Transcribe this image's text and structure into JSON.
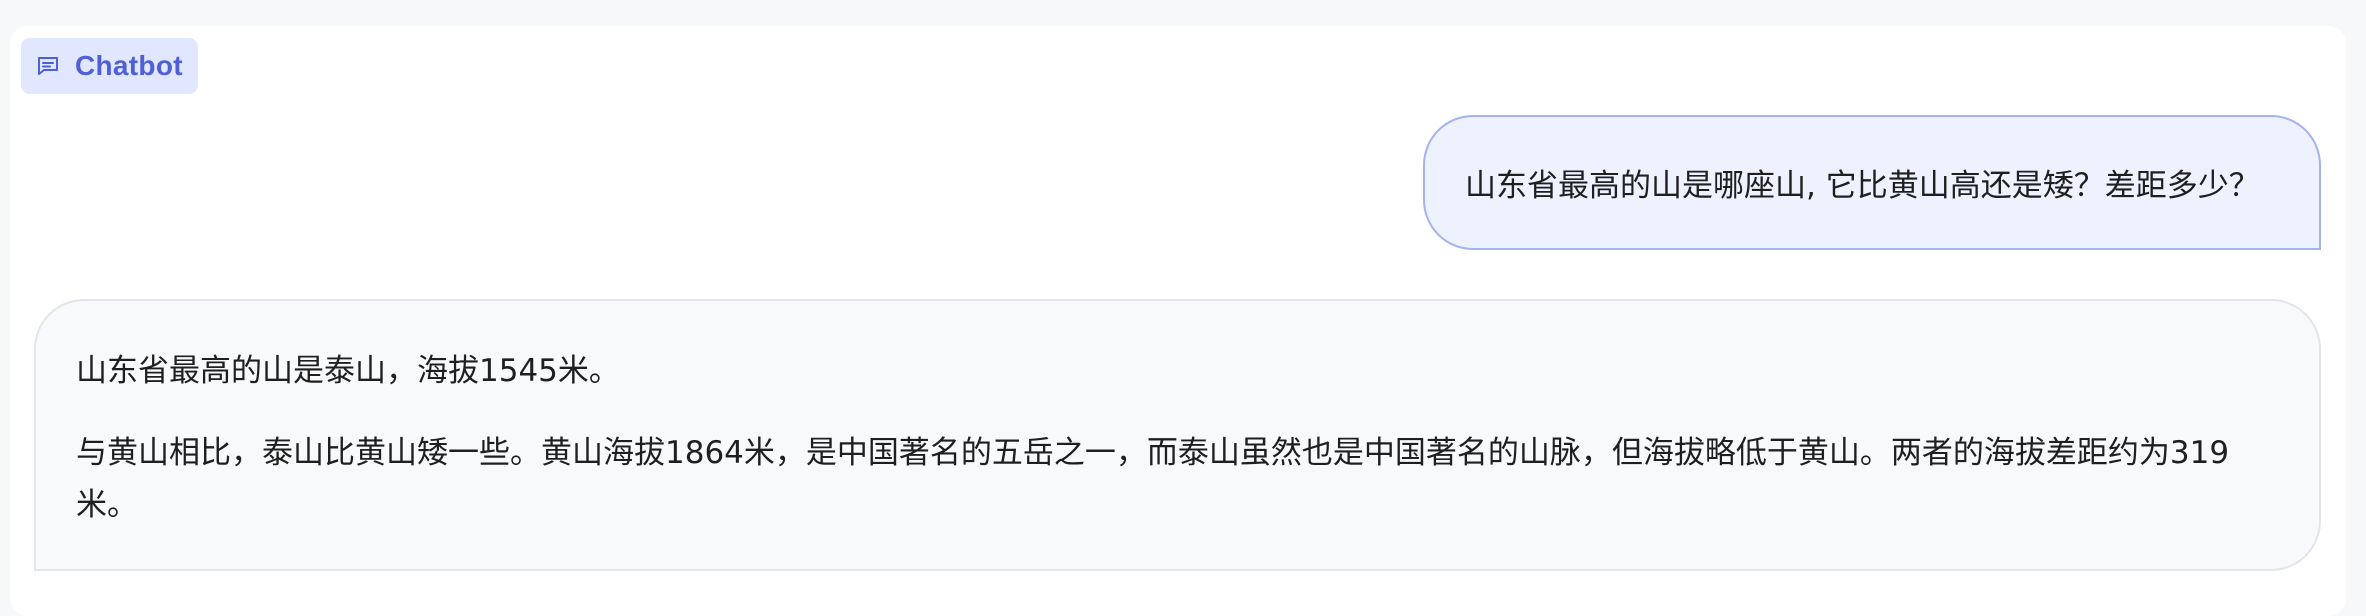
{
  "header": {
    "label": "Chatbot",
    "icon": "chat-bubble-icon",
    "accent_color": "#4f5fd6"
  },
  "messages": [
    {
      "role": "user",
      "text": "山东省最高的山是哪座山, 它比黄山高还是矮？差距多少？"
    },
    {
      "role": "assistant",
      "paragraphs": [
        "山东省最高的山是泰山，海拔1545米。",
        "与黄山相比，泰山比黄山矮一些。黄山海拔1864米，是中国著名的五岳之一，而泰山虽然也是中国著名的山脉，但海拔略低于黄山。两者的海拔差距约为319米。"
      ]
    }
  ]
}
